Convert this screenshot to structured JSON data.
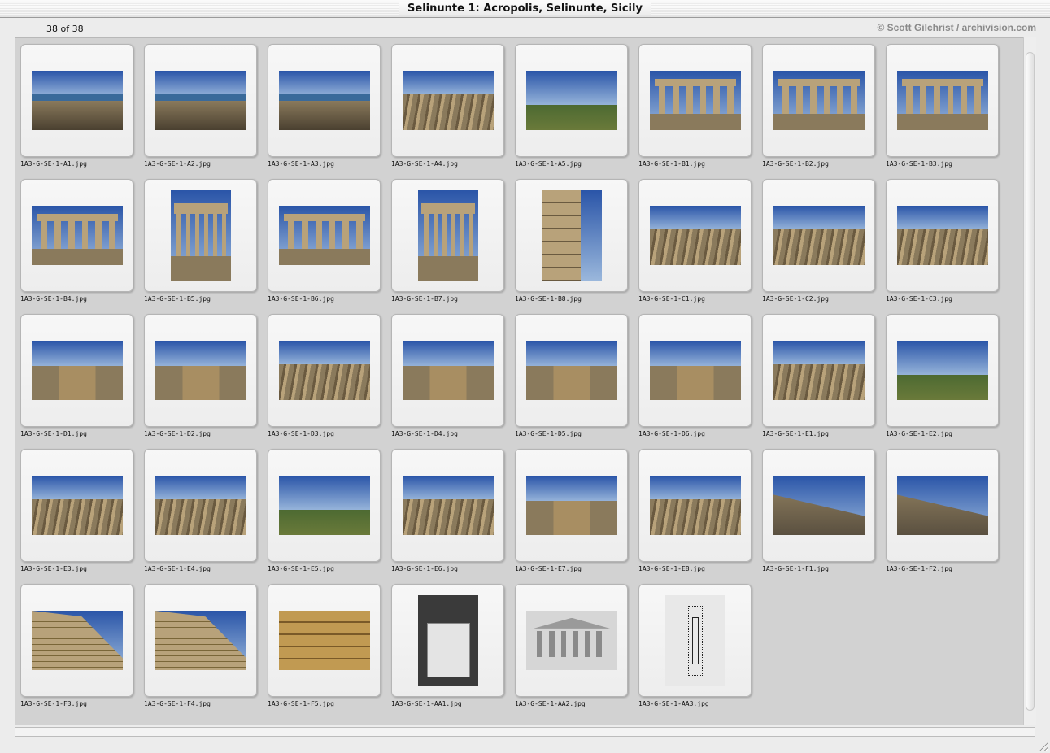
{
  "window": {
    "title": "Selinunte 1: Acropolis, Selinunte, Sicily"
  },
  "header": {
    "count": "38 of 38",
    "credit": "© Scott Gilchrist / archivision.com"
  },
  "thumbnails": [
    {
      "filename": "1A3-G-SE-1-A1.jpg",
      "scene": "coast"
    },
    {
      "filename": "1A3-G-SE-1-A2.jpg",
      "scene": "coast"
    },
    {
      "filename": "1A3-G-SE-1-A3.jpg",
      "scene": "coast"
    },
    {
      "filename": "1A3-G-SE-1-A4.jpg",
      "scene": "ruins"
    },
    {
      "filename": "1A3-G-SE-1-A5.jpg",
      "scene": "field"
    },
    {
      "filename": "1A3-G-SE-1-B1.jpg",
      "scene": "temple"
    },
    {
      "filename": "1A3-G-SE-1-B2.jpg",
      "scene": "temple"
    },
    {
      "filename": "1A3-G-SE-1-B3.jpg",
      "scene": "temple"
    },
    {
      "filename": "1A3-G-SE-1-B4.jpg",
      "scene": "temple"
    },
    {
      "filename": "1A3-G-SE-1-B5.jpg",
      "scene": "temple-portrait"
    },
    {
      "filename": "1A3-G-SE-1-B6.jpg",
      "scene": "temple"
    },
    {
      "filename": "1A3-G-SE-1-B7.jpg",
      "scene": "temple-portrait"
    },
    {
      "filename": "1A3-G-SE-1-B8.jpg",
      "scene": "stone-portrait"
    },
    {
      "filename": "1A3-G-SE-1-C1.jpg",
      "scene": "ruins"
    },
    {
      "filename": "1A3-G-SE-1-C2.jpg",
      "scene": "ruins"
    },
    {
      "filename": "1A3-G-SE-1-C3.jpg",
      "scene": "ruins"
    },
    {
      "filename": "1A3-G-SE-1-D1.jpg",
      "scene": "road"
    },
    {
      "filename": "1A3-G-SE-1-D2.jpg",
      "scene": "road"
    },
    {
      "filename": "1A3-G-SE-1-D3.jpg",
      "scene": "ruins"
    },
    {
      "filename": "1A3-G-SE-1-D4.jpg",
      "scene": "road"
    },
    {
      "filename": "1A3-G-SE-1-D5.jpg",
      "scene": "road"
    },
    {
      "filename": "1A3-G-SE-1-D6.jpg",
      "scene": "road"
    },
    {
      "filename": "1A3-G-SE-1-E1.jpg",
      "scene": "ruins"
    },
    {
      "filename": "1A3-G-SE-1-E2.jpg",
      "scene": "field"
    },
    {
      "filename": "1A3-G-SE-1-E3.jpg",
      "scene": "ruins"
    },
    {
      "filename": "1A3-G-SE-1-E4.jpg",
      "scene": "ruins"
    },
    {
      "filename": "1A3-G-SE-1-E5.jpg",
      "scene": "field"
    },
    {
      "filename": "1A3-G-SE-1-E6.jpg",
      "scene": "ruins"
    },
    {
      "filename": "1A3-G-SE-1-E7.jpg",
      "scene": "road"
    },
    {
      "filename": "1A3-G-SE-1-E8.jpg",
      "scene": "ruins"
    },
    {
      "filename": "1A3-G-SE-1-F1.jpg",
      "scene": "slope"
    },
    {
      "filename": "1A3-G-SE-1-F2.jpg",
      "scene": "slope"
    },
    {
      "filename": "1A3-G-SE-1-F3.jpg",
      "scene": "wall"
    },
    {
      "filename": "1A3-G-SE-1-F4.jpg",
      "scene": "wall"
    },
    {
      "filename": "1A3-G-SE-1-F5.jpg",
      "scene": "masonry"
    },
    {
      "filename": "1A3-G-SE-1-AA1.jpg",
      "scene": "drawing-portrait"
    },
    {
      "filename": "1A3-G-SE-1-AA2.jpg",
      "scene": "elevation"
    },
    {
      "filename": "1A3-G-SE-1-AA3.jpg",
      "scene": "plan-portrait"
    }
  ],
  "colors": {
    "sky_top": "#2a55a8",
    "sky_bottom": "#9bb8dc",
    "sea": "#3a6a9a",
    "stone": "#8a7a5c",
    "stone_light": "#b8a27a",
    "grass": "#4d6a32",
    "earth": "#a88e62"
  }
}
